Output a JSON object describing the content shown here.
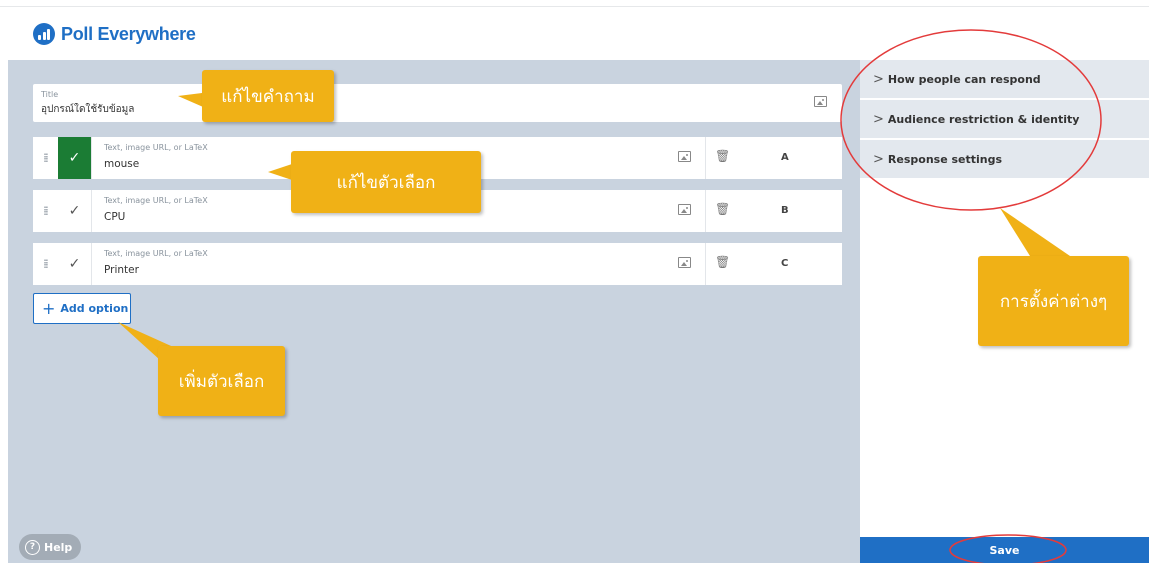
{
  "app": {
    "name": "Poll Everywhere"
  },
  "title_field": {
    "label": "Title",
    "value": "อุปกรณ์ใดใช้รับข้อมูล"
  },
  "options": [
    {
      "placeholder": "Text, image URL, or LaTeX",
      "value": "mouse",
      "letter": "A",
      "correct": true
    },
    {
      "placeholder": "Text, image URL, or LaTeX",
      "value": "CPU",
      "letter": "B",
      "correct": false
    },
    {
      "placeholder": "Text, image URL, or LaTeX",
      "value": "Printer",
      "letter": "C",
      "correct": false
    }
  ],
  "add_option": {
    "label": "Add option"
  },
  "help": {
    "label": "Help"
  },
  "sidebar": {
    "sections": [
      {
        "label": "How people can respond"
      },
      {
        "label": "Audience restriction & identity"
      },
      {
        "label": "Response settings"
      }
    ],
    "save_label": "Save"
  },
  "annotations": {
    "edit_question": "แก้ไขคำถาม",
    "edit_options": "แก้ไขตัวเลือก",
    "add_option": "เพิ่มตัวเลือก",
    "settings": "การตั้งค่าต่างๆ"
  },
  "colors": {
    "brand": "#1f6fc5",
    "correct": "#1b7c34",
    "callout": "#f0b116",
    "highlight_ring": "#e33b3b"
  }
}
